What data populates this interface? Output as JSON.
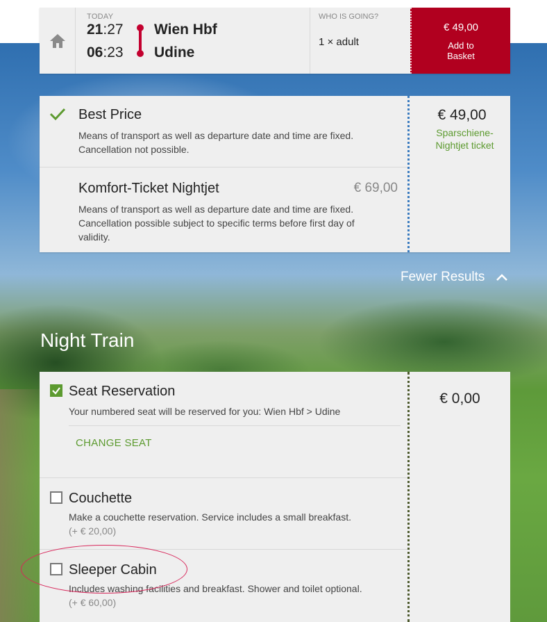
{
  "header": {
    "today_label": "TODAY",
    "departure_time": {
      "hours": "21",
      "minutes": ":27"
    },
    "arrival_time": {
      "hours": "06",
      "minutes": ":23"
    },
    "from_station": "Wien Hbf",
    "to_station": "Udine",
    "who_label": "WHO IS GOING?",
    "who_value": "1 × adult",
    "basket_price": "€ 49,00",
    "basket_label_line1": "Add to",
    "basket_label_line2": "Basket"
  },
  "fares": [
    {
      "title": "Best Price",
      "description": "Means of transport as well as departure date and time are fixed. Cancellation not possible.",
      "price": "€ 49,00",
      "ticket_line1": "Sparschiene-",
      "ticket_line2": "Nightjet ticket",
      "selected": true
    },
    {
      "title": "Komfort-Ticket Nightjet",
      "description": "Means of transport as well as departure date and time are fixed. Cancellation possible subject to specific terms before first day of validity.",
      "price": "€ 69,00",
      "selected": false
    }
  ],
  "fewer_results_label": "Fewer Results",
  "section_title": "Night Train",
  "night_train": {
    "seat": {
      "title": "Seat Reservation",
      "description": "Your numbered seat will be reserved for you: Wien Hbf > Udine",
      "change_label": "CHANGE SEAT",
      "price": "€  0,00",
      "checked": true
    },
    "couchette": {
      "title": "Couchette",
      "description": "Make a couchette reservation. Service includes a small breakfast.",
      "surcharge": "(+ €  20,00)",
      "checked": false
    },
    "sleeper": {
      "title": "Sleeper Cabin",
      "description": "Includes washing facilities and breakfast. Shower and toilet optional.",
      "surcharge": "(+ €  60,00)",
      "checked": false
    }
  },
  "colors": {
    "brand_red": "#b1001f",
    "accent_green": "#5c9a2f",
    "route_red": "#c3002f",
    "annotation": "#d8265a"
  }
}
